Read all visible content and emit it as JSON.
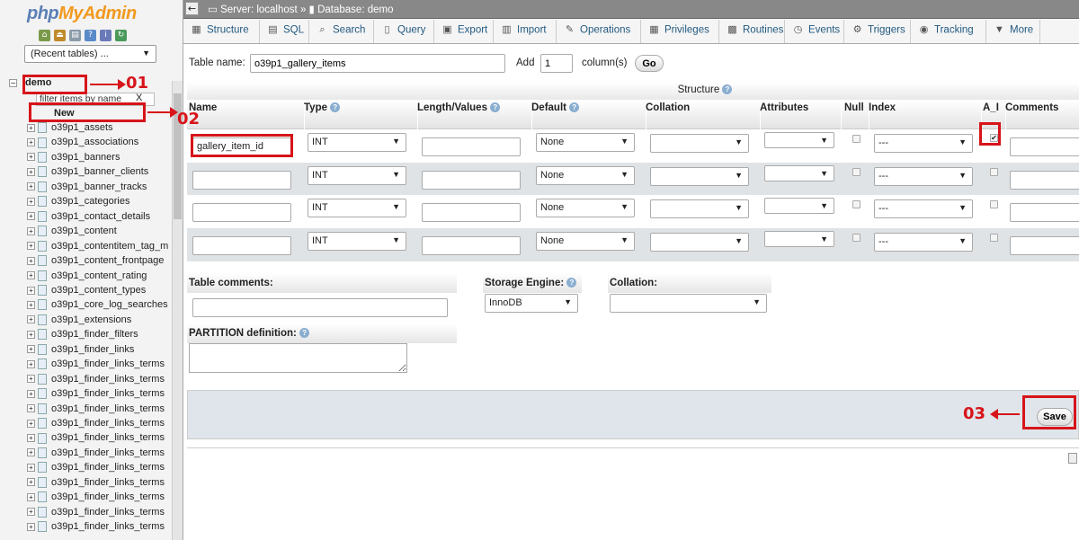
{
  "sidebar": {
    "logo_php": "php",
    "logo_my": "MyAdmin",
    "recent_tables": "(Recent tables) ...",
    "database": "demo",
    "filter_placeholder": "filter items by name",
    "filter_clear": "X",
    "new_label": "New",
    "tables": [
      "o39p1_assets",
      "o39p1_associations",
      "o39p1_banners",
      "o39p1_banner_clients",
      "o39p1_banner_tracks",
      "o39p1_categories",
      "o39p1_contact_details",
      "o39p1_content",
      "o39p1_contentitem_tag_m",
      "o39p1_content_frontpage",
      "o39p1_content_rating",
      "o39p1_content_types",
      "o39p1_core_log_searches",
      "o39p1_extensions",
      "o39p1_finder_filters",
      "o39p1_finder_links",
      "o39p1_finder_links_terms",
      "o39p1_finder_links_terms",
      "o39p1_finder_links_terms",
      "o39p1_finder_links_terms",
      "o39p1_finder_links_terms",
      "o39p1_finder_links_terms",
      "o39p1_finder_links_terms",
      "o39p1_finder_links_terms",
      "o39p1_finder_links_terms",
      "o39p1_finder_links_terms",
      "o39p1_finder_links_terms",
      "o39p1_finder_links_terms"
    ]
  },
  "topbar": {
    "server": "Server: localhost",
    "sep": "»",
    "database": "Database: demo"
  },
  "tabs": [
    {
      "label": "Structure",
      "icon": "structure-icon",
      "glyph": "▦"
    },
    {
      "label": "SQL",
      "icon": "sql-icon",
      "glyph": "▤"
    },
    {
      "label": "Search",
      "icon": "search-icon",
      "glyph": "⌕"
    },
    {
      "label": "Query",
      "icon": "query-icon",
      "glyph": "▯"
    },
    {
      "label": "Export",
      "icon": "export-icon",
      "glyph": "▣"
    },
    {
      "label": "Import",
      "icon": "import-icon",
      "glyph": "▥"
    },
    {
      "label": "Operations",
      "icon": "operations-icon",
      "glyph": "✎"
    },
    {
      "label": "Privileges",
      "icon": "privileges-icon",
      "glyph": "▦"
    },
    {
      "label": "Routines",
      "icon": "routines-icon",
      "glyph": "▩"
    },
    {
      "label": "Events",
      "icon": "events-icon",
      "glyph": "◷"
    },
    {
      "label": "Triggers",
      "icon": "triggers-icon",
      "glyph": "⚙"
    },
    {
      "label": "Tracking",
      "icon": "tracking-icon",
      "glyph": "◉"
    },
    {
      "label": "More",
      "icon": "more-icon",
      "glyph": "▼"
    }
  ],
  "form": {
    "table_name_label": "Table name:",
    "table_name_value": "o39p1_gallery_items",
    "add_label": "Add",
    "add_value": "1",
    "columns_label": "column(s)",
    "go_label": "Go",
    "structure_label": "Structure"
  },
  "columns": {
    "name": "Name",
    "type": "Type",
    "length": "Length/Values",
    "default": "Default",
    "collation": "Collation",
    "attributes": "Attributes",
    "null": "Null",
    "index": "Index",
    "ai": "A_I",
    "comments": "Comments"
  },
  "rows": [
    {
      "name": "gallery_item_id",
      "type": "INT",
      "default": "None",
      "index": "---",
      "ai_checked": true
    },
    {
      "name": "",
      "type": "INT",
      "default": "None",
      "index": "---",
      "ai_checked": false
    },
    {
      "name": "",
      "type": "INT",
      "default": "None",
      "index": "---",
      "ai_checked": false
    },
    {
      "name": "",
      "type": "INT",
      "default": "None",
      "index": "---",
      "ai_checked": false
    }
  ],
  "bottom": {
    "table_comments": "Table comments:",
    "storage_engine": "Storage Engine:",
    "storage_value": "InnoDB",
    "collation": "Collation:",
    "partition": "PARTITION definition:",
    "save": "Save"
  },
  "annotations": {
    "step1": "01",
    "step2": "02",
    "step3": "03",
    "color": "#d7141a"
  }
}
